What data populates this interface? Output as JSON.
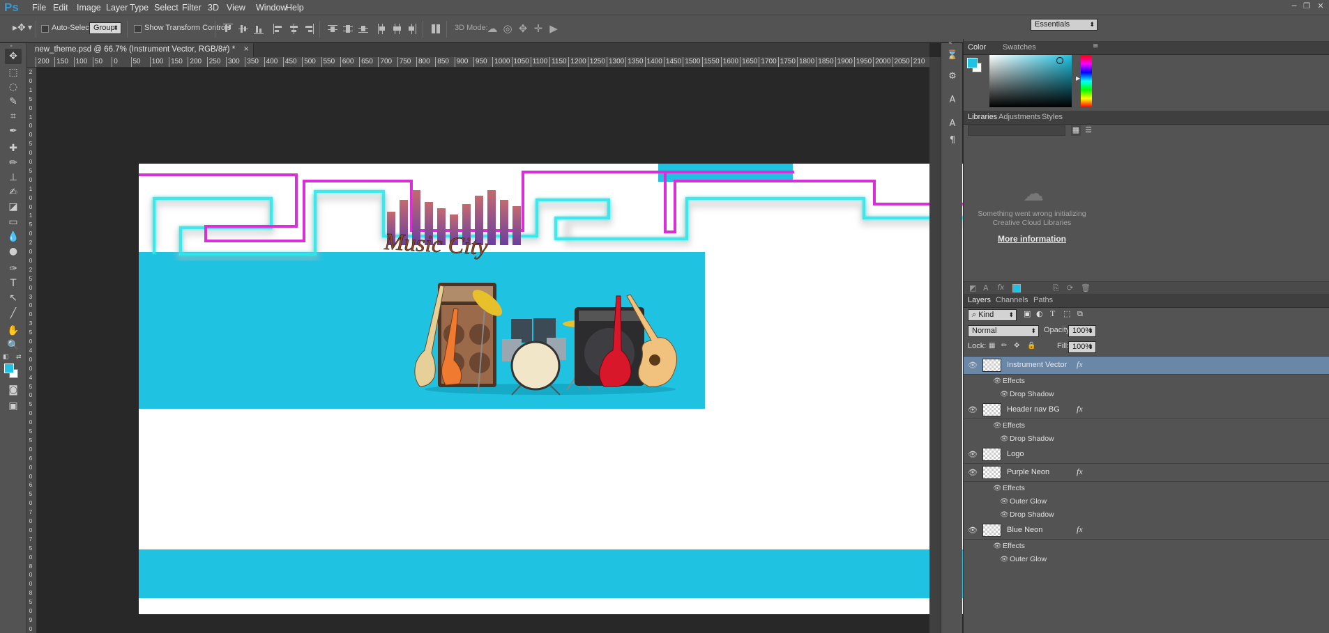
{
  "app": {
    "logo": "Ps"
  },
  "menu": [
    "File",
    "Edit",
    "Image",
    "Layer",
    "Type",
    "Select",
    "Filter",
    "3D",
    "View",
    "Window",
    "Help"
  ],
  "options_bar": {
    "auto_select_label": "Auto-Select:",
    "auto_select_value": "Group",
    "transform_label": "Show Transform Controls",
    "mode_label": "3D Mode:",
    "workspace": "Essentials"
  },
  "document": {
    "tab_title": "new_theme.psd @ 66.7% (Instrument Vector, RGB/8#) *",
    "close_glyph": "×",
    "ruler_h": [
      "200",
      "150",
      "100",
      "50",
      "0",
      "50",
      "100",
      "150",
      "200",
      "250",
      "300",
      "350",
      "400",
      "450",
      "500",
      "550",
      "600",
      "650",
      "700",
      "750",
      "800",
      "850",
      "900",
      "950",
      "1000",
      "1050",
      "1100",
      "1150",
      "1200",
      "1250",
      "1300",
      "1350",
      "1400",
      "1450",
      "1500",
      "1550",
      "1600",
      "1650",
      "1700",
      "1750",
      "1800",
      "1850",
      "1900",
      "1950",
      "2000",
      "2050",
      "210"
    ],
    "ruler_v": [
      "2",
      "0",
      "1",
      "5",
      "0",
      "1",
      "0",
      "0",
      "5",
      "0",
      "0",
      "5",
      "0",
      "1",
      "0",
      "0",
      "1",
      "5",
      "0",
      "2",
      "0",
      "0",
      "2",
      "5",
      "0",
      "3",
      "0",
      "0",
      "3",
      "5",
      "0",
      "4",
      "0",
      "0",
      "4",
      "5",
      "0",
      "5",
      "0",
      "0",
      "5",
      "5",
      "0",
      "6",
      "0",
      "0",
      "6",
      "5",
      "0",
      "7",
      "0",
      "0",
      "7",
      "5",
      "0",
      "8",
      "0",
      "0",
      "8",
      "5",
      "0",
      "9",
      "0"
    ],
    "logo_text": "Music City"
  },
  "colors": {
    "cyan": "#1fc2e1",
    "purple_neon": "#d92fd6",
    "blue_neon": "#2fe6ea",
    "selection": "#6b87a8"
  },
  "color_panel": {
    "tabs": [
      "Color",
      "Swatches"
    ]
  },
  "libraries_panel": {
    "tabs": [
      "Libraries",
      "Adjustments",
      "Styles"
    ],
    "error_line1": "Something went wrong initializing",
    "error_line2": "Creative Cloud Libraries",
    "more_info": "More information"
  },
  "layers_panel": {
    "tabs": [
      "Layers",
      "Channels",
      "Paths"
    ],
    "kind": "Kind",
    "blend_mode": "Normal",
    "opacity_label": "Opacity:",
    "opacity": "100%",
    "lock_label": "Lock:",
    "fill_label": "Fill:",
    "fill": "100%",
    "layers": [
      {
        "name": "Instrument Vector",
        "fx": "fx",
        "effects_label": "Effects",
        "effects": [
          "Drop Shadow"
        ],
        "selected": true
      },
      {
        "name": "Header nav BG",
        "fx": "fx",
        "effects_label": "Effects",
        "effects": [
          "Drop Shadow"
        ]
      },
      {
        "name": "Logo"
      },
      {
        "name": "Purple Neon",
        "fx": "fx",
        "effects_label": "Effects",
        "effects": [
          "Outer Glow",
          "Drop Shadow"
        ]
      },
      {
        "name": "Blue Neon",
        "fx": "fx",
        "effects_label": "Effects",
        "effects": [
          "Outer Glow"
        ]
      }
    ]
  }
}
